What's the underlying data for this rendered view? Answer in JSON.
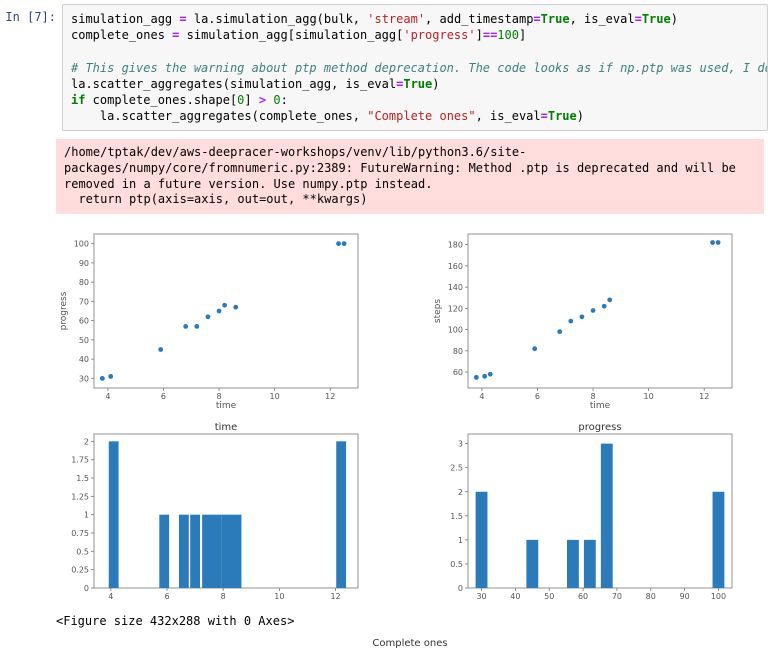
{
  "cell": {
    "prompt": "In [7]:",
    "code_lines": [
      [
        [
          "id",
          "simulation_agg"
        ],
        [
          "txt",
          " "
        ],
        [
          "op",
          "="
        ],
        [
          "txt",
          " la.simulation_agg(bulk, "
        ],
        [
          "str",
          "'stream'"
        ],
        [
          "txt",
          ", add_timestamp"
        ],
        [
          "op",
          "="
        ],
        [
          "bool",
          "True"
        ],
        [
          "txt",
          ", is_eval"
        ],
        [
          "op",
          "="
        ],
        [
          "bool",
          "True"
        ],
        [
          "txt",
          ")"
        ]
      ],
      [
        [
          "id",
          "complete_ones"
        ],
        [
          "txt",
          " "
        ],
        [
          "op",
          "="
        ],
        [
          "txt",
          " simulation_agg[simulation_agg["
        ],
        [
          "str",
          "'progress'"
        ],
        [
          "txt",
          "]"
        ],
        [
          "op",
          "=="
        ],
        [
          "num",
          "100"
        ],
        [
          "txt",
          "]"
        ]
      ],
      [
        [
          "txt",
          ""
        ]
      ],
      [
        [
          "cmt",
          "# This gives the warning about ptp method deprecation. The code looks as if np.ptp was used, I don't know how to"
        ]
      ],
      [
        [
          "txt",
          "la.scatter_aggregates(simulation_agg, is_eval"
        ],
        [
          "op",
          "="
        ],
        [
          "bool",
          "True"
        ],
        [
          "txt",
          ")"
        ]
      ],
      [
        [
          "kw",
          "if"
        ],
        [
          "txt",
          " complete_ones.shape["
        ],
        [
          "num",
          "0"
        ],
        [
          "txt",
          "] "
        ],
        [
          "op",
          ">"
        ],
        [
          "txt",
          " "
        ],
        [
          "num",
          "0"
        ],
        [
          "txt",
          ":"
        ]
      ],
      [
        [
          "txt",
          "    la.scatter_aggregates(complete_ones, "
        ],
        [
          "str",
          "\"Complete ones\""
        ],
        [
          "txt",
          ", is_eval"
        ],
        [
          "op",
          "="
        ],
        [
          "bool",
          "True"
        ],
        [
          "txt",
          ")"
        ]
      ]
    ]
  },
  "warning": "/home/tptak/dev/aws-deepracer-workshops/venv/lib/python3.6/site-packages/numpy/core/fromnumeric.py:2389: FutureWarning: Method .ptp is deprecated and will be removed in a future version. Use numpy.ptp instead.\n  return ptp(axis=axis, out=out, **kwargs)",
  "figure_text": "<Figure size 432x288 with 0 Axes>",
  "subtitle": "Complete ones",
  "chart_data": [
    {
      "type": "scatter",
      "title": "",
      "xlabel": "time",
      "ylabel": "progress",
      "xlim": [
        3.5,
        13
      ],
      "ylim": [
        25,
        105
      ],
      "xticks": [
        4,
        6,
        8,
        10,
        12
      ],
      "yticks": [
        30,
        40,
        50,
        60,
        70,
        80,
        90,
        100
      ],
      "points": [
        {
          "x": 3.8,
          "y": 30
        },
        {
          "x": 4.1,
          "y": 31
        },
        {
          "x": 5.9,
          "y": 45
        },
        {
          "x": 6.8,
          "y": 57
        },
        {
          "x": 7.2,
          "y": 57
        },
        {
          "x": 7.6,
          "y": 62
        },
        {
          "x": 8.0,
          "y": 65
        },
        {
          "x": 8.2,
          "y": 68
        },
        {
          "x": 8.6,
          "y": 67
        },
        {
          "x": 12.3,
          "y": 100
        },
        {
          "x": 12.5,
          "y": 100
        }
      ]
    },
    {
      "type": "scatter",
      "title": "",
      "xlabel": "time",
      "ylabel": "steps",
      "xlim": [
        3.5,
        13
      ],
      "ylim": [
        45,
        190
      ],
      "xticks": [
        4,
        6,
        8,
        10,
        12
      ],
      "yticks": [
        60,
        80,
        100,
        120,
        140,
        160,
        180
      ],
      "points": [
        {
          "x": 3.8,
          "y": 55
        },
        {
          "x": 4.1,
          "y": 56
        },
        {
          "x": 4.3,
          "y": 58
        },
        {
          "x": 5.9,
          "y": 82
        },
        {
          "x": 6.8,
          "y": 98
        },
        {
          "x": 7.2,
          "y": 108
        },
        {
          "x": 7.6,
          "y": 112
        },
        {
          "x": 8.0,
          "y": 118
        },
        {
          "x": 8.4,
          "y": 122
        },
        {
          "x": 8.6,
          "y": 128
        },
        {
          "x": 12.3,
          "y": 182
        },
        {
          "x": 12.5,
          "y": 182
        }
      ]
    },
    {
      "type": "bar",
      "title": "time",
      "xlabel": "",
      "ylabel": "",
      "xlim": [
        3.4,
        12.8
      ],
      "ylim": [
        0,
        2.1
      ],
      "xticks": [
        4,
        6,
        8,
        10,
        12
      ],
      "yticks": [
        0.0,
        0.25,
        0.5,
        0.75,
        1.0,
        1.25,
        1.5,
        1.75,
        2.0
      ],
      "bars": [
        {
          "x": 4.1,
          "h": 2,
          "w": 0.35
        },
        {
          "x": 5.9,
          "h": 1,
          "w": 0.35
        },
        {
          "x": 6.6,
          "h": 1,
          "w": 0.35
        },
        {
          "x": 7.0,
          "h": 1,
          "w": 0.35
        },
        {
          "x": 7.6,
          "h": 1,
          "w": 0.7
        },
        {
          "x": 8.3,
          "h": 1,
          "w": 0.7
        },
        {
          "x": 12.2,
          "h": 2,
          "w": 0.35
        }
      ]
    },
    {
      "type": "bar",
      "title": "progress",
      "xlabel": "",
      "ylabel": "",
      "xlim": [
        26,
        104
      ],
      "ylim": [
        0,
        3.2
      ],
      "xticks": [
        30,
        40,
        50,
        60,
        70,
        80,
        90,
        100
      ],
      "yticks": [
        0.0,
        0.5,
        1.0,
        1.5,
        2.0,
        2.5,
        3.0
      ],
      "bars": [
        {
          "x": 30,
          "h": 2,
          "w": 3.5
        },
        {
          "x": 45,
          "h": 1,
          "w": 3.5
        },
        {
          "x": 57,
          "h": 1,
          "w": 3.5
        },
        {
          "x": 62,
          "h": 1,
          "w": 3.5
        },
        {
          "x": 67,
          "h": 3,
          "w": 3.5
        },
        {
          "x": 100,
          "h": 2,
          "w": 3.5
        }
      ]
    }
  ]
}
